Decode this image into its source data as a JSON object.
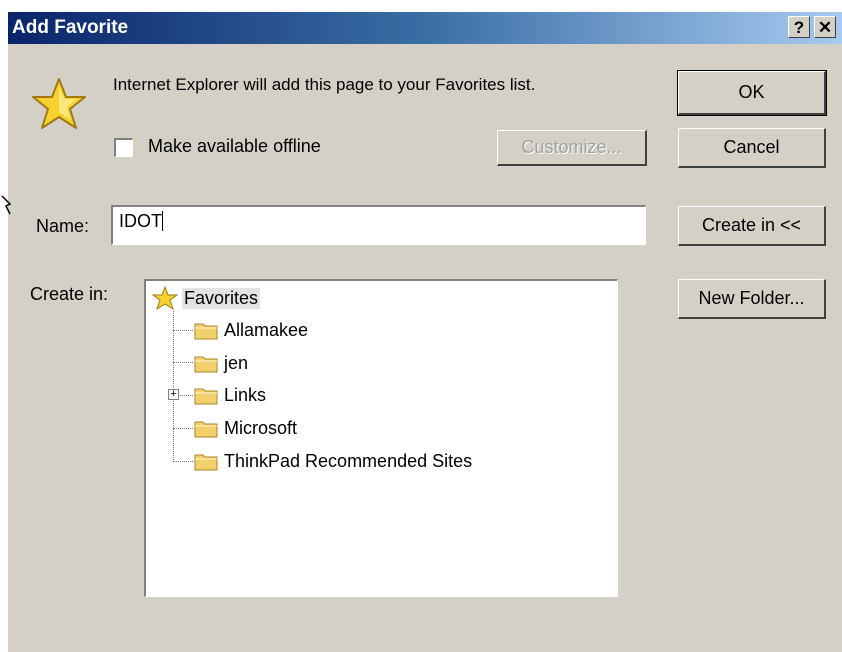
{
  "window": {
    "title": "Add Favorite",
    "help_button": "?",
    "close_button": "✕"
  },
  "message": "Internet Explorer will add this page to your Favorites list.",
  "offline": {
    "label": "Make available offline",
    "checked": false
  },
  "buttons": {
    "ok": "OK",
    "cancel": "Cancel",
    "customize": "Customize...",
    "create_in": "Create in <<",
    "new_folder": "New Folder..."
  },
  "name": {
    "label": "Name:",
    "value": "IDOT"
  },
  "create_in": {
    "label": "Create in:"
  },
  "tree": {
    "root": "Favorites",
    "items": [
      {
        "label": "Allamakee",
        "icon": "folder-icon",
        "expandable": false
      },
      {
        "label": "jen",
        "icon": "folder-icon",
        "expandable": false
      },
      {
        "label": "Links",
        "icon": "folder-icon",
        "expandable": true
      },
      {
        "label": "Microsoft",
        "icon": "folder-icon",
        "expandable": false
      },
      {
        "label": "ThinkPad Recommended Sites",
        "icon": "folder-icon",
        "expandable": false
      }
    ]
  },
  "colors": {
    "face": "#d4d0c8",
    "title_start": "#0a246a",
    "title_end": "#a6caf0",
    "star": "#f5d230",
    "folder": "#f2d06b"
  }
}
